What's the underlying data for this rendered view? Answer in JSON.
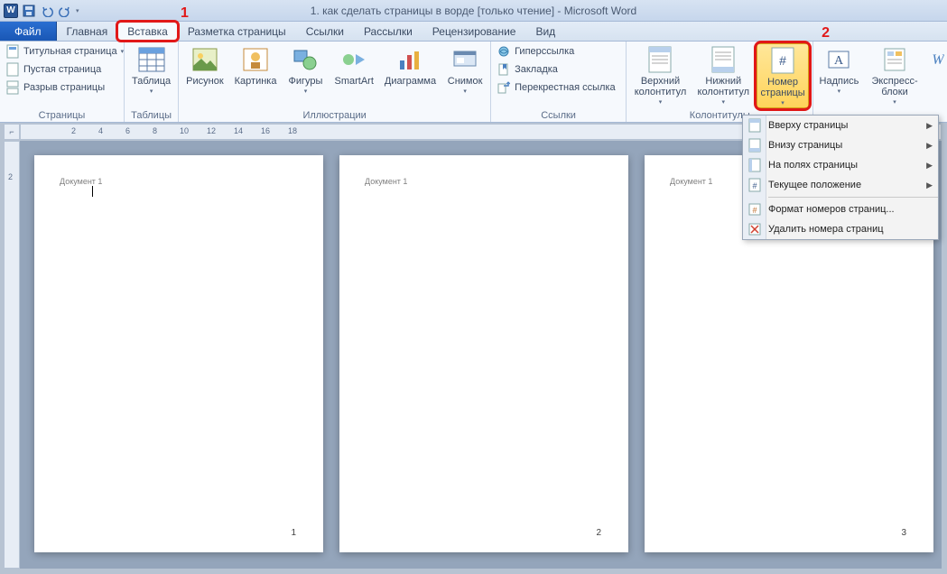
{
  "title": "1. как сделать страницы в ворде [только чтение] - Microsoft Word",
  "app_initial": "W",
  "annotations": {
    "one": "1",
    "two": "2"
  },
  "tabs": {
    "file": "Файл",
    "items": [
      "Главная",
      "Вставка",
      "Разметка страницы",
      "Ссылки",
      "Рассылки",
      "Рецензирование",
      "Вид"
    ],
    "active_index": 1
  },
  "ribbon": {
    "pages": {
      "label": "Страницы",
      "cover": "Титульная страница",
      "blank": "Пустая страница",
      "break": "Разрыв страницы"
    },
    "tables": {
      "label": "Таблицы",
      "table": "Таблица"
    },
    "illustrations": {
      "label": "Иллюстрации",
      "picture": "Рисунок",
      "clipart": "Картинка",
      "shapes": "Фигуры",
      "smartart": "SmartArt",
      "chart": "Диаграмма",
      "screenshot": "Снимок"
    },
    "links": {
      "label": "Ссылки",
      "hyperlink": "Гиперссылка",
      "bookmark": "Закладка",
      "crossref": "Перекрестная ссылка"
    },
    "headerfooter": {
      "label": "Колонтитулы",
      "header": "Верхний колонтитул",
      "footer": "Нижний колонтитул",
      "pagenum": "Номер страницы"
    },
    "text": {
      "textbox": "Надпись",
      "quickparts": "Экспресс-блоки",
      "wordart": "W"
    }
  },
  "dropdown": {
    "top": "Вверху страницы",
    "bottom": "Внизу страницы",
    "margins": "На полях страницы",
    "current": "Текущее положение",
    "format": "Формат номеров страниц...",
    "remove": "Удалить номера страниц"
  },
  "document": {
    "header_text": "Документ 1",
    "page_numbers": [
      "1",
      "2",
      "3"
    ]
  },
  "ruler_h": [
    "2",
    "4",
    "6",
    "8",
    "10",
    "12",
    "14",
    "16",
    "18"
  ],
  "ruler_v_start": "2"
}
